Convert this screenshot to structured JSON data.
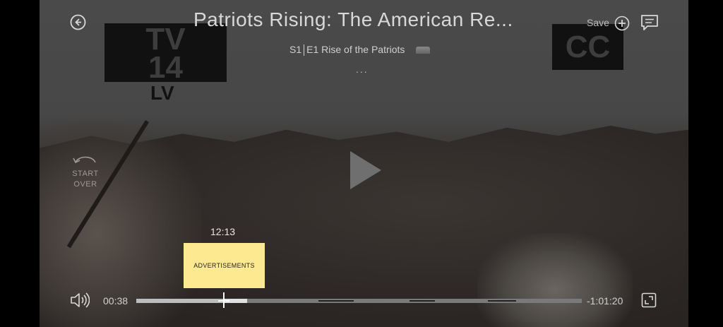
{
  "player": {
    "title": "Patriots Rising: The American Re...",
    "episode_season": "S1",
    "episode_number": "E1",
    "episode_title": "Rise of the Patriots",
    "more_label": "...",
    "save_label": "Save",
    "start_over": {
      "line1": "START",
      "line2": "OVER"
    },
    "thumbnail_time": "12:13",
    "ad_label": "ADVERTISEMENTS",
    "elapsed": "00:38",
    "remaining": "-1:01:20",
    "progress_fraction": 0.198
  },
  "rating_bug": {
    "line1": "TV",
    "line2": "14",
    "line3": "LV"
  },
  "cc_bug": "CC",
  "icons": {
    "back": "back-arrow-icon",
    "save": "plus-circle-icon",
    "chat": "chat-bubble-icon",
    "start_over": "rewind-arc-icon",
    "play": "play-icon",
    "volume": "volume-icon",
    "fullscreen": "fullscreen-icon",
    "network": "network-logo-icon"
  },
  "colors": {
    "ad_highlight": "#fde98f",
    "track": "#7a7a7a",
    "played": "#bdbdbd"
  }
}
